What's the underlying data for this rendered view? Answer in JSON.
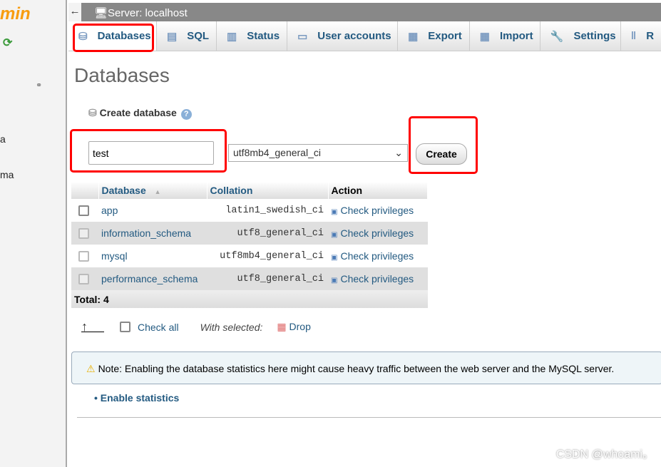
{
  "sidebar": {
    "logo": "min",
    "items": [
      "a",
      "ma"
    ]
  },
  "topbar": {
    "back": "←",
    "server": "Server: localhost"
  },
  "tabs": [
    {
      "label": "Databases",
      "icon": "database-icon",
      "active": true
    },
    {
      "label": "SQL",
      "icon": "sql-icon"
    },
    {
      "label": "Status",
      "icon": "status-icon"
    },
    {
      "label": "User accounts",
      "icon": "users-icon"
    },
    {
      "label": "Export",
      "icon": "export-icon"
    },
    {
      "label": "Import",
      "icon": "import-icon"
    },
    {
      "label": "Settings",
      "icon": "wrench-icon"
    },
    {
      "label": "R",
      "icon": "replication-icon"
    }
  ],
  "page_title": "Databases",
  "create": {
    "label": "Create database",
    "name_value": "test",
    "collation": "utf8mb4_general_ci",
    "button": "Create"
  },
  "table": {
    "headers": [
      "Database",
      "Collation",
      "Action"
    ],
    "rows": [
      {
        "name": "app",
        "collation": "latin1_swedish_ci",
        "action": "Check privileges"
      },
      {
        "name": "information_schema",
        "collation": "utf8_general_ci",
        "action": "Check privileges"
      },
      {
        "name": "mysql",
        "collation": "utf8mb4_general_ci",
        "action": "Check privileges"
      },
      {
        "name": "performance_schema",
        "collation": "utf8_general_ci",
        "action": "Check privileges"
      }
    ],
    "total": "Total: 4"
  },
  "bulk": {
    "check_all": "Check all",
    "with_selected": "With selected:",
    "drop": "Drop"
  },
  "note": "Note: Enabling the database statistics here might cause heavy traffic between the web server and the MySQL server.",
  "enable_stats": "Enable statistics",
  "watermark": "CSDN @whoami。",
  "colors": {
    "link": "#235a81",
    "highlight": "#ff0000",
    "logo": "#f89c0e"
  }
}
